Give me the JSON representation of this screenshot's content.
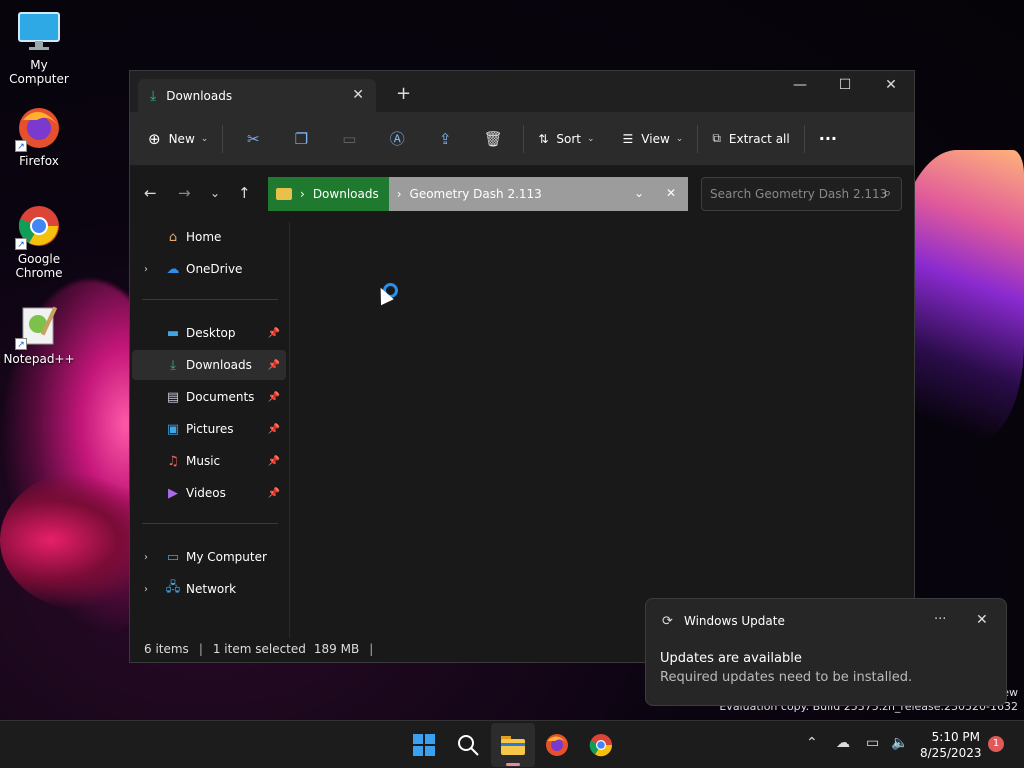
{
  "desktop": {
    "icons": [
      {
        "label": "My Computer",
        "icon": "monitor-icon"
      },
      {
        "label": "Firefox",
        "icon": "firefox-icon"
      },
      {
        "label": "Google Chrome",
        "icon": "chrome-icon"
      },
      {
        "label": "Notepad++",
        "icon": "notepadpp-icon"
      }
    ]
  },
  "window": {
    "tab_title": "Downloads",
    "toolbar": {
      "new_label": "New",
      "sort_label": "Sort",
      "view_label": "View",
      "extract_label": "Extract all"
    },
    "address": {
      "segments": [
        "Downloads",
        "Geometry Dash 2.113"
      ]
    },
    "search_placeholder": "Search Geometry Dash 2.113",
    "sidebar": {
      "home": "Home",
      "onedrive": "OneDrive",
      "quick": [
        "Desktop",
        "Downloads",
        "Documents",
        "Pictures",
        "Music",
        "Videos"
      ],
      "my_computer": "My Computer",
      "network": "Network"
    },
    "status": {
      "items": "6 items",
      "selected": "1 item selected",
      "size": "189 MB"
    }
  },
  "toast": {
    "app": "Windows Update",
    "heading": "Updates are available",
    "body": "Required updates need to be installed."
  },
  "watermark": {
    "line_top": "ew",
    "line": "Evaluation copy. Build 25375.zn_release.230520-1632"
  },
  "taskbar": {
    "time": "5:10 PM",
    "date": "8/25/2023",
    "badge": "1"
  },
  "colors": {
    "accent": "#2a8fe8",
    "address_green": "#1f7a2f",
    "window_bg": "#191919"
  }
}
